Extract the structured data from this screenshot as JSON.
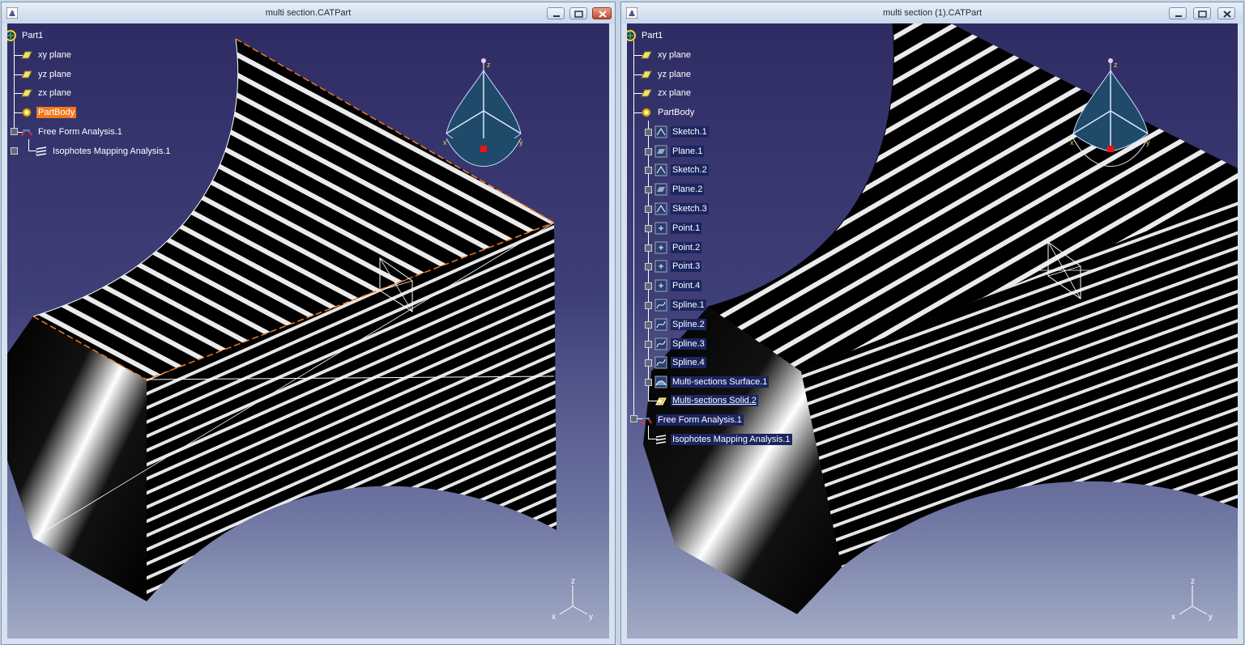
{
  "windows": [
    {
      "id": "left",
      "title": "multi section.CATPart",
      "tree": [
        {
          "label": "Part1",
          "icon": "part-icon",
          "selected": false
        },
        {
          "label": "xy plane",
          "icon": "plane-icon"
        },
        {
          "label": "yz plane",
          "icon": "plane-icon"
        },
        {
          "label": "zx plane",
          "icon": "plane-icon"
        },
        {
          "label": "PartBody",
          "icon": "body-gear-icon",
          "selected": true
        },
        {
          "label": "Free Form Analysis.1",
          "icon": "analysis-icon"
        },
        {
          "label": "Isophotes Mapping Analysis.1",
          "icon": "isophote-icon"
        }
      ]
    },
    {
      "id": "right",
      "title": "multi section (1).CATPart",
      "tree": [
        {
          "label": "Part1",
          "icon": "part-icon"
        },
        {
          "label": "xy plane",
          "icon": "plane-icon"
        },
        {
          "label": "yz plane",
          "icon": "plane-icon"
        },
        {
          "label": "zx plane",
          "icon": "plane-icon"
        },
        {
          "label": "PartBody",
          "icon": "body-gear-icon"
        },
        {
          "label": "Sketch.1",
          "icon": "sketch-icon"
        },
        {
          "label": "Plane.1",
          "icon": "plane-feature-icon"
        },
        {
          "label": "Sketch.2",
          "icon": "sketch-icon"
        },
        {
          "label": "Plane.2",
          "icon": "plane-feature-icon"
        },
        {
          "label": "Sketch.3",
          "icon": "sketch-icon"
        },
        {
          "label": "Point.1",
          "icon": "point-icon"
        },
        {
          "label": "Point.2",
          "icon": "point-icon"
        },
        {
          "label": "Point.3",
          "icon": "point-icon"
        },
        {
          "label": "Point.4",
          "icon": "point-icon"
        },
        {
          "label": "Spline.1",
          "icon": "spline-icon"
        },
        {
          "label": "Spline.2",
          "icon": "spline-icon"
        },
        {
          "label": "Spline.3",
          "icon": "spline-icon"
        },
        {
          "label": "Spline.4",
          "icon": "spline-icon"
        },
        {
          "label": "Multi-sections Surface.1",
          "icon": "surface-icon"
        },
        {
          "label": "Multi-sections Solid.2",
          "icon": "solid-icon"
        },
        {
          "label": "Free Form Analysis.1",
          "icon": "analysis-icon"
        },
        {
          "label": "Isophotes Mapping Analysis.1",
          "icon": "isophote-icon"
        }
      ]
    }
  ],
  "compass": {
    "x_label": "x",
    "y_label": "y",
    "z_label": "z"
  },
  "axis_triad": {
    "x_label": "x",
    "y_label": "y",
    "z_label": "z"
  },
  "colors": {
    "selection": "#f0781e",
    "highlight": "#1b2560",
    "background_top": "#2f2c64",
    "background_bottom": "#a3abc6",
    "compass_fill": "#1f4a6a"
  }
}
